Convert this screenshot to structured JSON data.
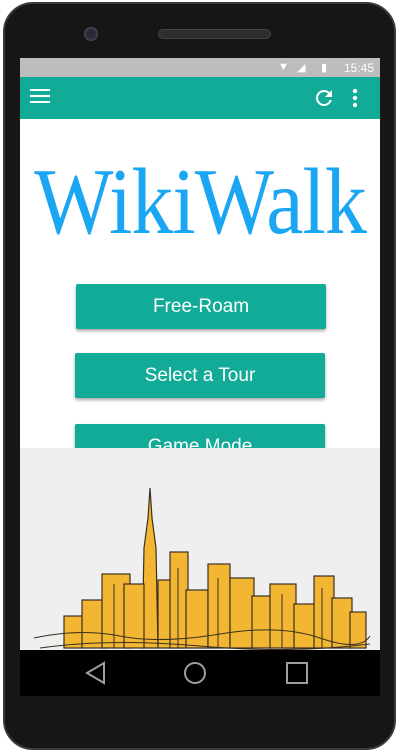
{
  "status_bar": {
    "time": "15:45",
    "icons": [
      "wifi-icon",
      "signal-icon",
      "battery-icon"
    ]
  },
  "app_bar": {
    "icons": [
      "hamburger-menu-icon",
      "refresh-icon",
      "more-vertical-icon"
    ],
    "color": "#12ab98"
  },
  "logo": {
    "text": "WikiWalk",
    "color": "#1aa6f2"
  },
  "buttons": {
    "free_roam": "Free-Roam",
    "select_tour": "Select a Tour",
    "game_mode": "Game Mode"
  },
  "nav_bar": {
    "icons": [
      "back-icon",
      "home-icon",
      "recents-icon"
    ]
  },
  "colors": {
    "accent": "#12ab98",
    "logo": "#1aa6f2",
    "skyline_fill": "#f2b632"
  }
}
